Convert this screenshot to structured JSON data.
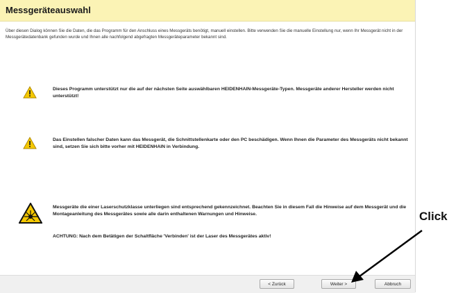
{
  "dialog": {
    "title": "Messgeräteauswahl",
    "intro": "Über diesen Dialog können Sie die Daten, die das Programm für den Anschluss eines Messgeräts benötigt, manuell einstellen. Bitte verwenden Sie die manuelle Einstellung nur, wenn Ihr Messgerät nicht in der Messgerätedatenbank gefunden wurde und Ihnen alle nachfolgend abgefragten Messgeräteparameter bekannt sind.",
    "warnings": [
      {
        "icon": "warning-icon",
        "text": "Dieses Programm unterstützt nur die auf der nächsten Seite auswählbaren HEIDENHAIN-Messgeräte-Typen. Messgeräte anderer Hersteller werden nicht unterstützt!"
      },
      {
        "icon": "warning-icon",
        "text": "Das Einstellen falscher Daten kann das Messgerät, die Schnittstellenkarte oder den PC beschädigen. Wenn Ihnen die Parameter des Messgeräts nicht bekannt sind, setzen Sie sich bitte vorher mit HEIDENHAIN in Verbindung."
      }
    ],
    "laser": {
      "icon": "laser-warning-icon",
      "text": "Messgeräte die einer Laserschutzklasse unterliegen sind entsprechend gekennzeichnet. Beachten Sie in diesem Fall die Hinweise auf dem Messgerät und die Montageanleitung des Messgerätes sowie alle darin enthaltenen Warnungen und Hinweise.",
      "attention": "ACHTUNG: Nach dem Betätigen der Schaltfläche 'Verbinden' ist der Laser des Messgerätes aktiv!"
    },
    "buttons": {
      "back": "< Zurück",
      "next": "Weiter >",
      "cancel": "Abbruch"
    }
  },
  "callout": {
    "label": "Click",
    "target": "next-button"
  },
  "colors": {
    "header_bg": "#fbf3b5",
    "warning_yellow": "#f5c800",
    "arrow": "#000000"
  }
}
